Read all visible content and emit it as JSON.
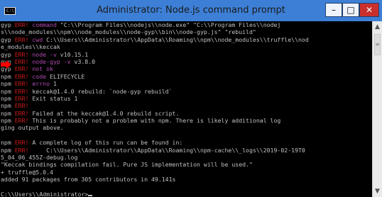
{
  "window": {
    "title": "Administrator: Node.js command prompt",
    "icon_label": "C:\\",
    "buttons": {
      "minimize": "–",
      "maximize": "□",
      "close": "✕"
    }
  },
  "console": {
    "lines": [
      [
        {
          "t": "gyp ",
          "c": "w"
        },
        {
          "t": "ERR!",
          "c": "r"
        },
        {
          "t": " command",
          "c": "m"
        },
        {
          "t": " \"C:\\\\Program Files\\\\nodejs\\\\node.exe\" \"C:\\\\Program Files\\\\nodej",
          "c": "w"
        }
      ],
      [
        {
          "t": "s\\\\node_modules\\\\npm\\\\node_modules\\\\node-gyp\\\\bin\\\\node-gyp.js\" \"rebuild\"",
          "c": "w"
        }
      ],
      [
        {
          "t": "gyp ",
          "c": "w"
        },
        {
          "t": "ERR!",
          "c": "r"
        },
        {
          "t": " cwd",
          "c": "m"
        },
        {
          "t": " C:\\\\Users\\\\Administrator\\\\AppData\\\\Roaming\\\\npm\\\\node_modules\\\\truffle\\\\nod",
          "c": "w"
        }
      ],
      [
        {
          "t": "e_modules\\\\keccak",
          "c": "w"
        }
      ],
      [
        {
          "t": "gyp ",
          "c": "w"
        },
        {
          "t": "ERR!",
          "c": "r"
        },
        {
          "t": " node -v",
          "c": "m"
        },
        {
          "t": " v10.15.1",
          "c": "w"
        }
      ],
      [
        {
          "t": "gyp ",
          "c": "w"
        },
        {
          "t": "ERR!",
          "c": "r"
        },
        {
          "t": " node-gyp -v",
          "c": "m"
        },
        {
          "t": " v3.8.0",
          "c": "w"
        }
      ],
      [
        {
          "t": "gyp ",
          "c": "w"
        },
        {
          "t": "ERR!",
          "c": "r"
        },
        {
          "t": " not ok",
          "c": "m"
        }
      ],
      [
        {
          "t": "npm ",
          "c": "w"
        },
        {
          "t": "ERR!",
          "c": "r"
        },
        {
          "t": " code",
          "c": "m"
        },
        {
          "t": " ELIFECYCLE",
          "c": "w"
        }
      ],
      [
        {
          "t": "npm ",
          "c": "w"
        },
        {
          "t": "ERR!",
          "c": "r"
        },
        {
          "t": " errno",
          "c": "m"
        },
        {
          "t": " 1",
          "c": "w"
        }
      ],
      [
        {
          "t": "npm ",
          "c": "w"
        },
        {
          "t": "ERR!",
          "c": "r"
        },
        {
          "t": " keccak@1.4.0 rebuild: `node-gyp rebuild`",
          "c": "w"
        }
      ],
      [
        {
          "t": "npm ",
          "c": "w"
        },
        {
          "t": "ERR!",
          "c": "r"
        },
        {
          "t": " Exit status 1",
          "c": "w"
        }
      ],
      [
        {
          "t": "npm ",
          "c": "w"
        },
        {
          "t": "ERR!",
          "c": "r"
        }
      ],
      [
        {
          "t": "npm ",
          "c": "w"
        },
        {
          "t": "ERR!",
          "c": "r"
        },
        {
          "t": " Failed at the keccak@1.4.0 rebuild script.",
          "c": "w"
        }
      ],
      [
        {
          "t": "npm ",
          "c": "w"
        },
        {
          "t": "ERR!",
          "c": "r"
        },
        {
          "t": " This is probably not a problem with npm. There is likely additional log",
          "c": "w"
        }
      ],
      [
        {
          "t": "ging output above.",
          "c": "w"
        }
      ],
      [
        {
          "t": "",
          "c": "w"
        }
      ],
      [
        {
          "t": "npm ",
          "c": "w"
        },
        {
          "t": "ERR!",
          "c": "r"
        },
        {
          "t": " A complete log of this run can be found in:",
          "c": "w"
        }
      ],
      [
        {
          "t": "npm ",
          "c": "w"
        },
        {
          "t": "ERR!",
          "c": "r"
        },
        {
          "t": "     C:\\\\Users\\\\Administrator\\\\AppData\\\\Roaming\\\\npm-cache\\\\_logs\\\\2019-02-19T0",
          "c": "w"
        }
      ],
      [
        {
          "t": "5_04_06_455Z-debug.log",
          "c": "w"
        }
      ],
      [
        {
          "t": "\"Keccak bindings compilation fail. Pure JS implementation will be used.\"",
          "c": "w"
        }
      ],
      [
        {
          "t": "+ truffle@5.0.4",
          "c": "w"
        }
      ],
      [
        {
          "t": "added 91 packages from 305 contributors in 49.141s",
          "c": "w"
        }
      ],
      [
        {
          "t": "",
          "c": "w"
        }
      ],
      [
        {
          "t": "C:\\\\Users\\\\Administrator>",
          "c": "w"
        }
      ]
    ]
  },
  "colors": {
    "console_bg": "#000000",
    "text_default": "#c0c0c0",
    "err_red": "#d21c1c",
    "magenta": "#b04ab0",
    "titlebar": "#3d7fd6",
    "close_red": "#c9302c",
    "arrow_red": "#ff0000"
  },
  "icons": {
    "window_icon": "cmd-icon",
    "annotation": "red-arrow-icon",
    "scroll_up": "chevron-up-icon",
    "scroll_down": "chevron-down-icon",
    "scroll_grip": "grip-icon"
  }
}
